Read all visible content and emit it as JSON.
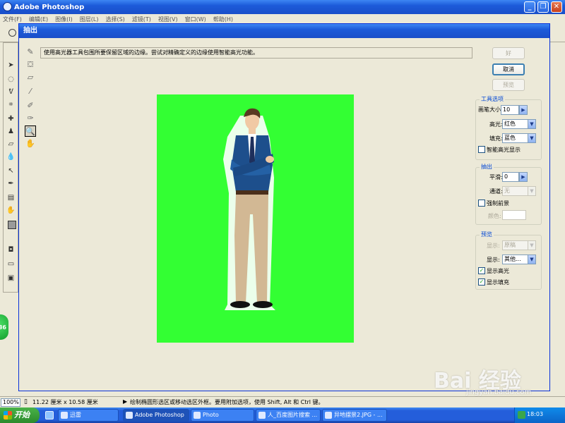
{
  "app": {
    "title": "Adobe Photoshop",
    "menu": [
      "文件(F)",
      "编辑(E)",
      "图像(I)",
      "图层(L)",
      "选择(S)",
      "滤镜(T)",
      "视图(V)",
      "窗口(W)",
      "帮助(H)"
    ]
  },
  "window_controls": {
    "minimize": "_",
    "restore": "❐",
    "close": "✕"
  },
  "dialog": {
    "title": "抽出",
    "hint": "使用高光器工具包围所要保留区域的边缘。尝试对精确定义的边缘使用智能高光功能。",
    "buttons": {
      "ok": "好",
      "cancel": "取消",
      "preview": "预览"
    },
    "tool_options": {
      "group_label": "工具选项",
      "brush_size_label": "画笔大小:",
      "brush_size_value": "10",
      "highlight_label": "高光:",
      "highlight_value": "红色",
      "fill_label": "填充:",
      "fill_value": "蓝色",
      "smart_highlight_label": "智能高光显示",
      "smart_highlight_checked": false
    },
    "extraction": {
      "group_label": "抽出",
      "smooth_label": "平滑:",
      "smooth_value": "0",
      "channel_label": "通道:",
      "channel_value": "无",
      "force_fg_label": "强制前景",
      "force_fg_checked": false,
      "color_label": "颜色:"
    },
    "preview_group": {
      "group_label": "预览",
      "show_label": "显示:",
      "show_value": "原稿",
      "display_label": "显示:",
      "display_value": "其他...",
      "show_highlight_label": "显示高光",
      "show_highlight_checked": true,
      "show_fill_label": "显示填充",
      "show_fill_checked": true,
      "check_mark": "✓"
    },
    "canvas_color": "#33ff33"
  },
  "statusbar": {
    "zoom": "100%",
    "doc_size": "11.22 厘米 x 10.58 厘米",
    "tip": "绘制椭圆形选区或移动选区外框。要用附加选项，使用 Shift, Alt 和 Ctrl 键。"
  },
  "badge": "36",
  "taskbar": {
    "start": "开始",
    "tasks": [
      "迅雷",
      "Adobe Photoshop",
      "Photo",
      "人_百度图片搜索 ...",
      "异地摆景2.JPG - ..."
    ],
    "clock": "18:03"
  },
  "watermark": {
    "logo": "Bai 经验",
    "url": "jingyan.baidu.com"
  }
}
